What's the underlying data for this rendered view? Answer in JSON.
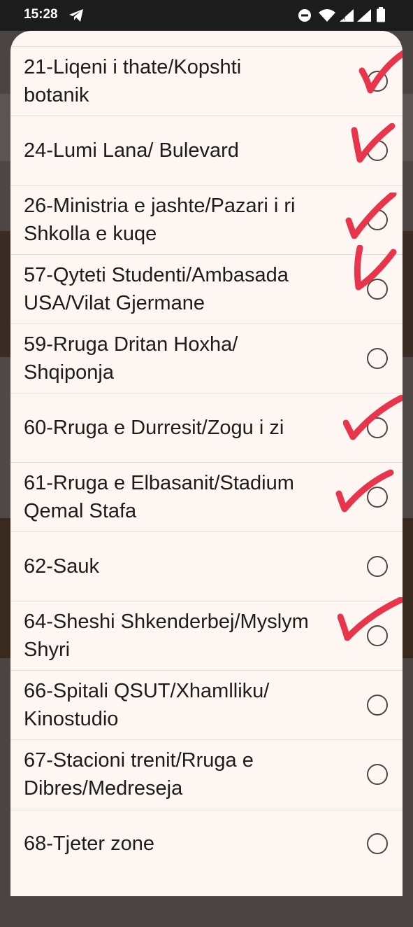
{
  "status_bar": {
    "time": "15:28"
  },
  "options": [
    {
      "label": "21-Liqeni i thate/Kopshti\nbotanik",
      "checked_mark": true
    },
    {
      "label": "24-Lumi Lana/ Bulevard",
      "checked_mark": true
    },
    {
      "label": "26-Ministria e jashte/Pazari i ri\nShkolla e kuqe",
      "checked_mark": true
    },
    {
      "label": "57-Qyteti Studenti/Ambasada\nUSA/Vilat Gjermane",
      "checked_mark": true
    },
    {
      "label": "59-Rruga Dritan Hoxha/\nShqiponja",
      "checked_mark": false
    },
    {
      "label": "60-Rruga e Durresit/Zogu i zi",
      "checked_mark": true
    },
    {
      "label": "61-Rruga e Elbasanit/Stadium\nQemal Stafa",
      "checked_mark": true
    },
    {
      "label": "62-Sauk",
      "checked_mark": false
    },
    {
      "label": "64-Sheshi Shkenderbej/Myslym\nShyri",
      "checked_mark": true
    },
    {
      "label": "66-Spitali QSUT/Xhamlliku/\nKinostudio",
      "checked_mark": false
    },
    {
      "label": "67-Stacioni trenit/Rruga e\nDibres/Medreseja",
      "checked_mark": false
    },
    {
      "label": "68-Tjeter zone",
      "checked_mark": false
    }
  ],
  "colors": {
    "annotation": "#e8354b",
    "radio": "#4f4540",
    "dialog_bg": "#fdf6f2"
  },
  "icons": [
    "telegram-icon",
    "dnd-icon",
    "wifi-icon",
    "signal-icon",
    "battery-icon",
    "radio-button-icon",
    "handwritten-check-icon"
  ]
}
